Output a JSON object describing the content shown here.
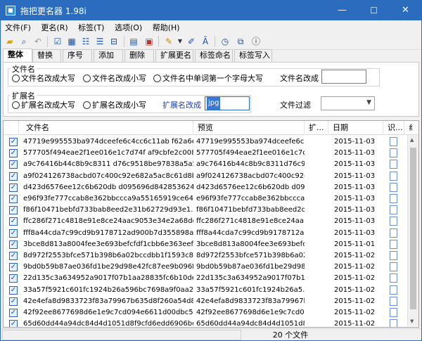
{
  "window": {
    "title": "拖把更名器 1.98i",
    "min": "—",
    "max": "☐",
    "close": "✕"
  },
  "menu": [
    "文件(F)",
    "更名(R)",
    "标签(T)",
    "选项(O)",
    "帮助(H)"
  ],
  "tabs": [
    "整体",
    "替换",
    "序号",
    "添加",
    "删除",
    "扩展更名",
    "标签命名",
    "标签写入"
  ],
  "filename_group": {
    "title": "文件名",
    "options": [
      "文件名改成大写",
      "文件名改成小写",
      "文件名中单词第一个字母大写"
    ],
    "rename_label": "文件名改成",
    "rename_value": ""
  },
  "ext_group": {
    "title": "扩展名",
    "options": [
      "扩展名改成大写",
      "扩展名改成小写"
    ],
    "rename_label": "扩展名改成",
    "rename_value": "jpg",
    "filter_label": "文件过滤",
    "filter_value": ""
  },
  "columns": [
    "文件名",
    "预览",
    "扩...",
    "日期",
    "识...",
    "纟"
  ],
  "rows": [
    {
      "name": "47719e995553ba974dceefe6c4cc6c11ab f62a6e9...",
      "preview": "47719e995553ba974dceefe6c4...",
      "date": "2015-11-03"
    },
    {
      "name": "577705f494eae2f1ee016e1c7d74f af9cbfe2c008...",
      "preview": "577705f494eae2f1ee016e1c7d...",
      "date": "2015-11-03"
    },
    {
      "name": "a9c76416b44c8b9c8311 d76c9518be97838a5a532...",
      "preview": "a9c76416b44c8b9c8311d76c95...",
      "date": "2015-11-03"
    },
    {
      "name": "a9f024126738acbd07c400c92e682a5ac8c61d8b0...",
      "preview": "a9f024126738acbd07c400c92e...",
      "date": "2015-11-03"
    },
    {
      "name": "d423d6576ee12c6b620db d095696d8428536243a3...",
      "preview": "d423d6576ee12c6b620db d0956...",
      "date": "2015-11-03"
    },
    {
      "name": "e96f93fe777ccab8e362bbccca9a55165919ce649...",
      "preview": "e96f93fe777ccab8e362bbccca...",
      "date": "2015-11-03"
    },
    {
      "name": "f86f10471bebfd733bab8eed2e31b62729d93e1...",
      "preview": "f86f10471bebfd733bab8eed2d...",
      "date": "2015-11-03"
    },
    {
      "name": "ffc286f271c4818e91e8ce24aac9053e34e2a68de...",
      "preview": "ffc286f271c4818e91e8ce24aa...",
      "date": "2015-11-03"
    },
    {
      "name": "fff8a44cda7c99cd9b9178712ad900b7d355898ab...",
      "preview": "fff8a44cda7c99cd9b9178712a...",
      "date": "2015-11-03"
    },
    {
      "name": "3bce8d813a8004fee3e693befcfdf1cbb6e363eef...",
      "preview": "3bce8d813a8004fee3e693befc...",
      "date": "2015-11-01"
    },
    {
      "name": "8d972f2553bfce571b398b6a02bccdbb1f1593c80...",
      "preview": "8d972f2553bfce571b398b6a02...",
      "date": "2015-11-02"
    },
    {
      "name": "9bd0b59b87ae036fd1be29d98e42fc87ee9b096f9...",
      "preview": "9bd0b59b87ae036fd1be29d98e...",
      "date": "2015-11-02"
    },
    {
      "name": "22d135c3a634952a9017f07b1aa28835fc6b10deb...",
      "preview": "22d135c3a634952a9017f07b1a...",
      "date": "2015-11-02"
    },
    {
      "name": "33a57f5921c601fc1924b26a596bc7698a9f0aa2...",
      "preview": "33a57f5921c601fc1924b26a5...",
      "date": "2015-11-02"
    },
    {
      "name": "42e4efa8d9833723f83a79967b635d8f260a54d84...",
      "preview": "42e4efa8d9833723f83a79967b...",
      "date": "2015-11-02"
    },
    {
      "name": "42f92ee8677698d6e1e9c7cd094e6611d00dbc522...",
      "preview": "42f92ee8677698d6e1e9c7cd09...",
      "date": "2015-11-02"
    },
    {
      "name": "65d60dd44a94dc84d4d1051d8f9cfd6edd6906bc56...",
      "preview": "65d60dd44a94dc84d4d1051d8f9...",
      "date": "2015-11-02"
    },
    {
      "name": "86a053d7e8fd3c8efeb13ddf1057cc3a31cad70b6...",
      "preview": "86a053d7e8fd3c8efeb13ddf10...",
      "date": "2015-11-02"
    }
  ],
  "status": {
    "count_text": "20 个文件"
  }
}
